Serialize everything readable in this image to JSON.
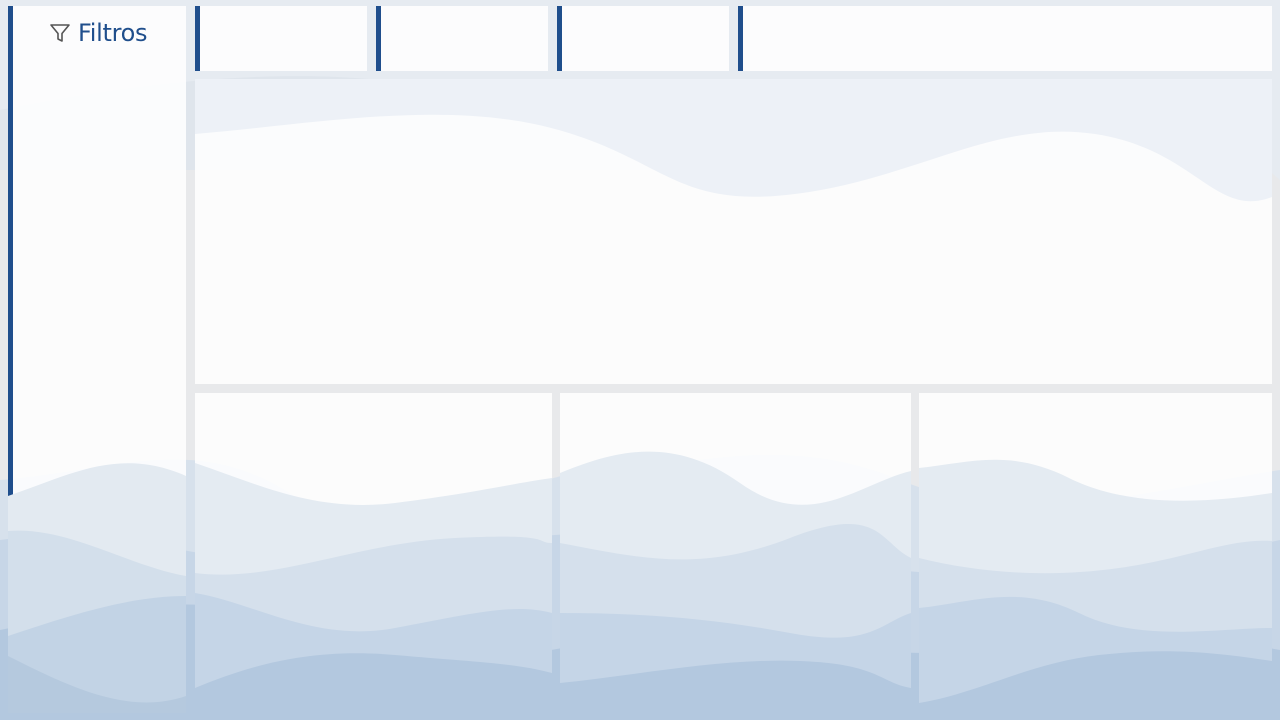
{
  "filters_panel": {
    "label": "Filtros",
    "icon": "filter-icon"
  },
  "kpi_cards": [
    {
      "name": "kpi-card-1"
    },
    {
      "name": "kpi-card-2"
    },
    {
      "name": "kpi-card-3"
    },
    {
      "name": "kpi-card-4"
    }
  ],
  "colors": {
    "accent": "#1f4e8c",
    "canvas": "#e8e9eb",
    "tile": "#ffffff",
    "wave_light": "#dbe5ef",
    "wave_mid": "#c3d4e6",
    "wave_dark": "#a9c2dc"
  }
}
